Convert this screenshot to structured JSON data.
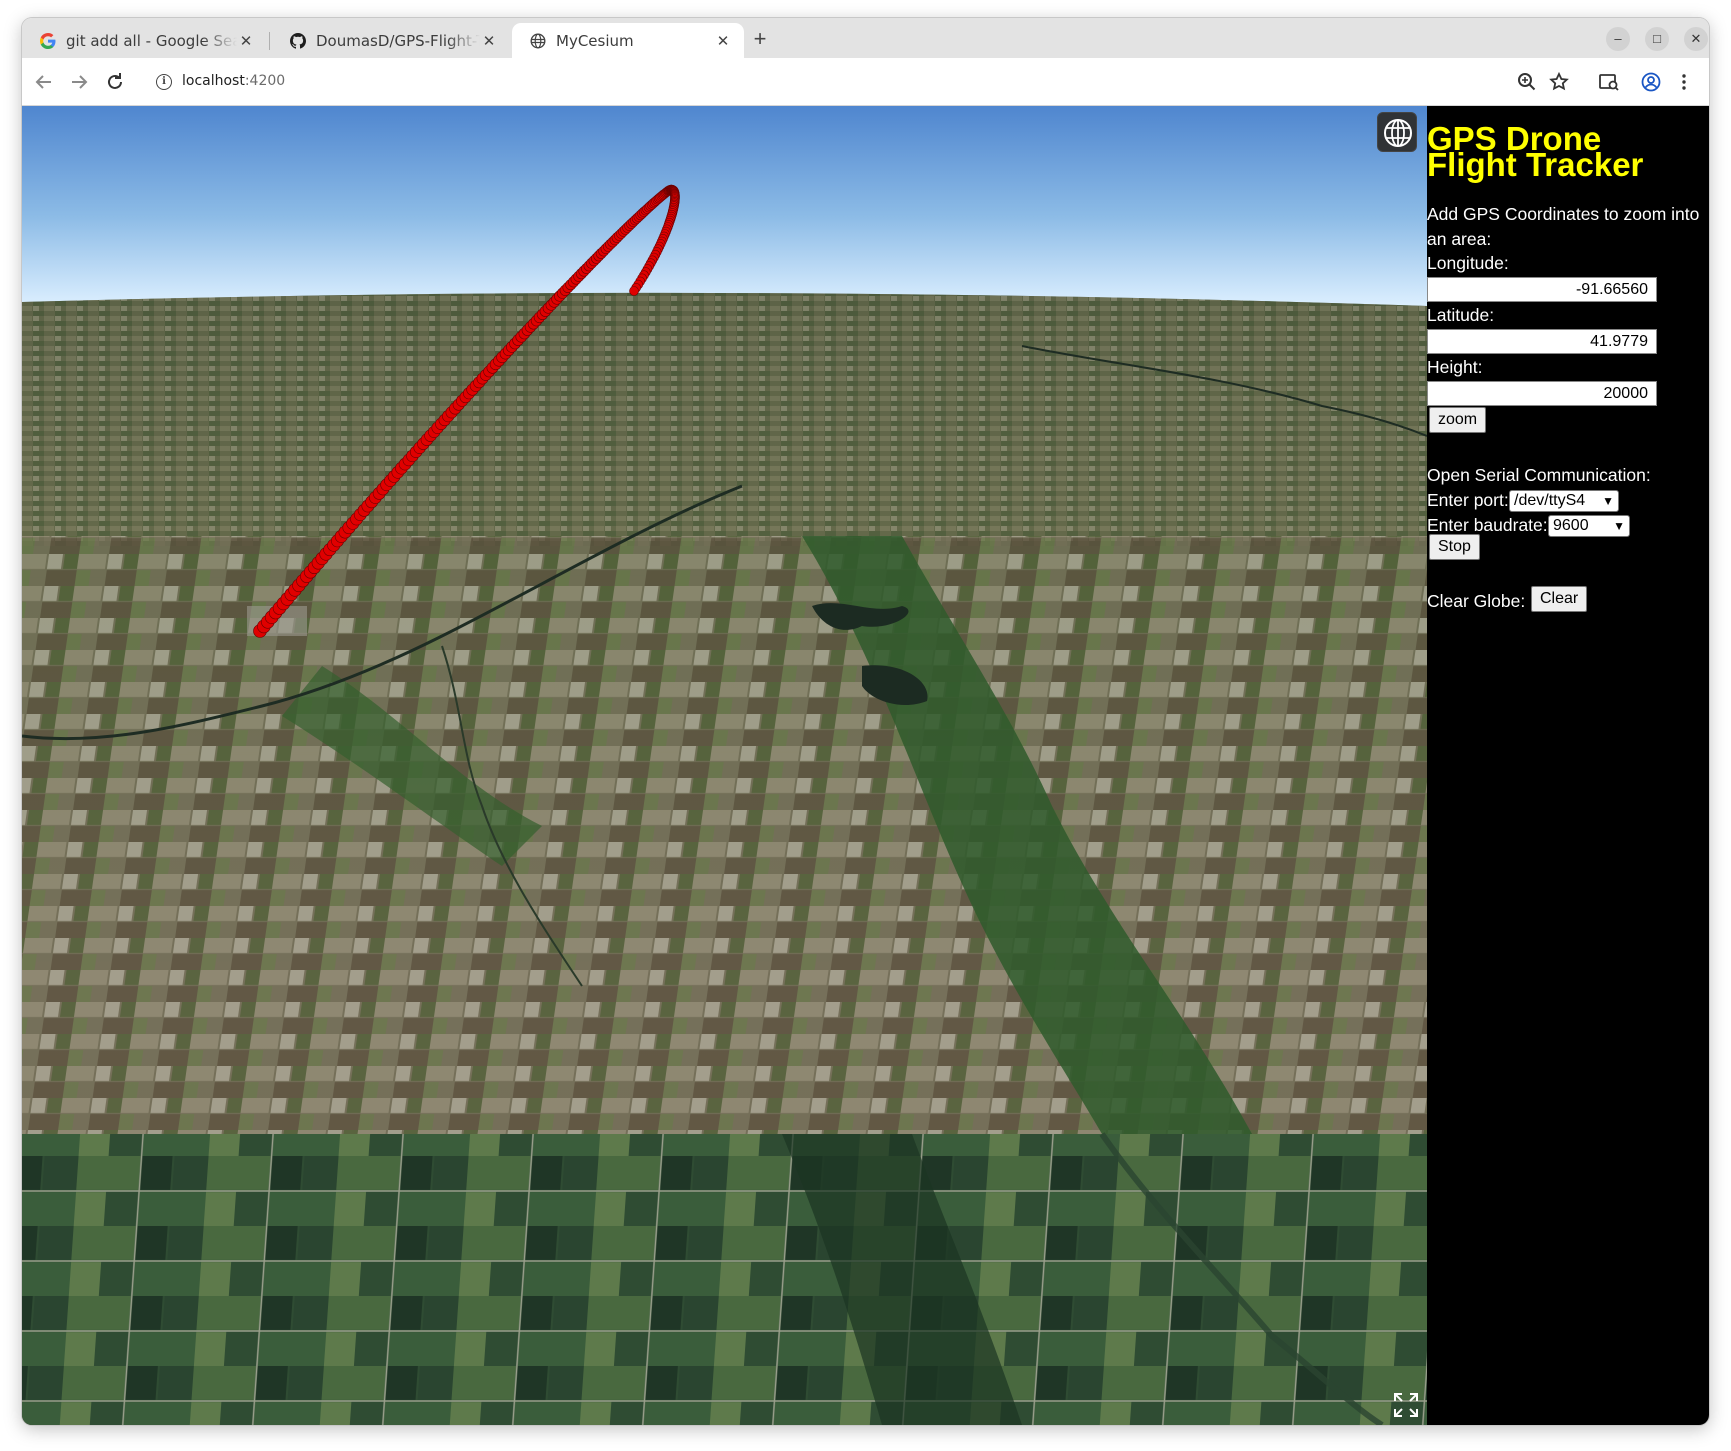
{
  "browser": {
    "tabs": [
      {
        "title": "git add all - Google Search",
        "favicon": "google-icon",
        "active": false
      },
      {
        "title": "DoumasD/GPS-Flight-Tracker",
        "favicon": "github-icon",
        "active": false
      },
      {
        "title": "MyCesium",
        "favicon": "globe-icon",
        "active": true
      }
    ],
    "new_tab_label": "+",
    "controls": {
      "minimize": "–",
      "maximize": "□",
      "close": "✕"
    },
    "address": {
      "host": "localhost",
      "port": ":4200"
    }
  },
  "panel": {
    "title": "GPS Drone Flight Tracker",
    "title_line1": "GPS Drone",
    "title_line2": "Flight Tracker",
    "intro_line1": "Add GPS Coordinates to zoom into",
    "intro_line2": "an area:",
    "longitude_label": "Longitude:",
    "longitude_value": "-91.66560",
    "latitude_label": "Latitude:",
    "latitude_value": "41.9779",
    "height_label": "Height:",
    "height_value": "20000",
    "zoom_button": "zoom",
    "serial_heading": "Open Serial Communication:",
    "port_label": "Enter port:",
    "port_value": "/dev/ttyS4",
    "baud_label": "Enter baudrate:",
    "baud_value": "9600",
    "stop_button": "Stop",
    "clear_label": "Clear Globe:",
    "clear_button": "Clear"
  },
  "colors": {
    "panel_title": "#ffff00",
    "panel_bg": "#000000",
    "flight_path": "#e00000"
  },
  "viewer": {
    "base_layer_icon": "globe-icon",
    "fullscreen_icon": "fullscreen-icon"
  }
}
